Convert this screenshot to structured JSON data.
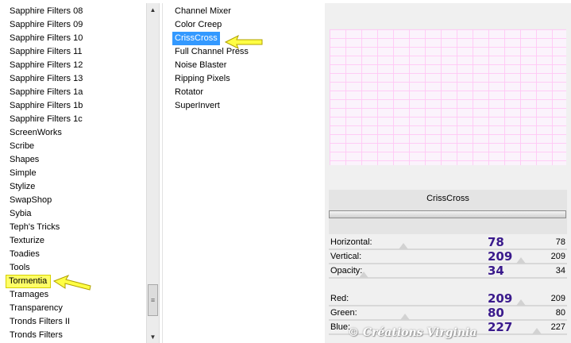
{
  "categories": [
    "Sapphire Filters 08",
    "Sapphire Filters 09",
    "Sapphire Filters 10",
    "Sapphire Filters 11",
    "Sapphire Filters 12",
    "Sapphire Filters 13",
    "Sapphire Filters 1a",
    "Sapphire Filters 1b",
    "Sapphire Filters 1c",
    "ScreenWorks",
    "Scribe",
    "Shapes",
    "Simple",
    "Stylize",
    "SwapShop",
    "Sybia",
    "Teph's Tricks",
    "Texturize",
    "Toadies",
    "Tools",
    "Tormentia",
    "Tramages",
    "Transparency",
    "Tronds Filters II",
    "Tronds Filters"
  ],
  "highlighted_category": "Tormentia",
  "filters": [
    "Channel Mixer",
    "Color Creep",
    "CrissCross",
    "Full Channel Press",
    "Noise Blaster",
    "Ripping Pixels",
    "Rotator",
    "SuperInvert"
  ],
  "selected_filter": "CrissCross",
  "filter_title": "CrissCross",
  "params_group1": [
    {
      "label": "Horizontal:",
      "value": "78",
      "annotation": "78",
      "level": 0.306
    },
    {
      "label": "Vertical:",
      "value": "209",
      "annotation": "209",
      "level": 0.82
    },
    {
      "label": "Opacity:",
      "value": "34",
      "annotation": "34",
      "level": 0.133
    }
  ],
  "params_group2": [
    {
      "label": "Red:",
      "value": "209",
      "annotation": "209",
      "level": 0.82
    },
    {
      "label": "Green:",
      "value": "80",
      "annotation": "80",
      "level": 0.314
    },
    {
      "label": "Blue:",
      "value": "227",
      "annotation": "227",
      "level": 0.89
    }
  ],
  "watermark": "© Créations Virginia",
  "colors": {
    "selection": "#3399ff",
    "highlight": "#ffff66",
    "annotation_text": "#3a1a8c",
    "arrow": "#ffff44"
  },
  "icons": {
    "scroll_up": "triangle-up-icon",
    "scroll_down": "triangle-down-icon",
    "grip": "grip-icon",
    "pointer": "arrow-pointer-icon"
  }
}
